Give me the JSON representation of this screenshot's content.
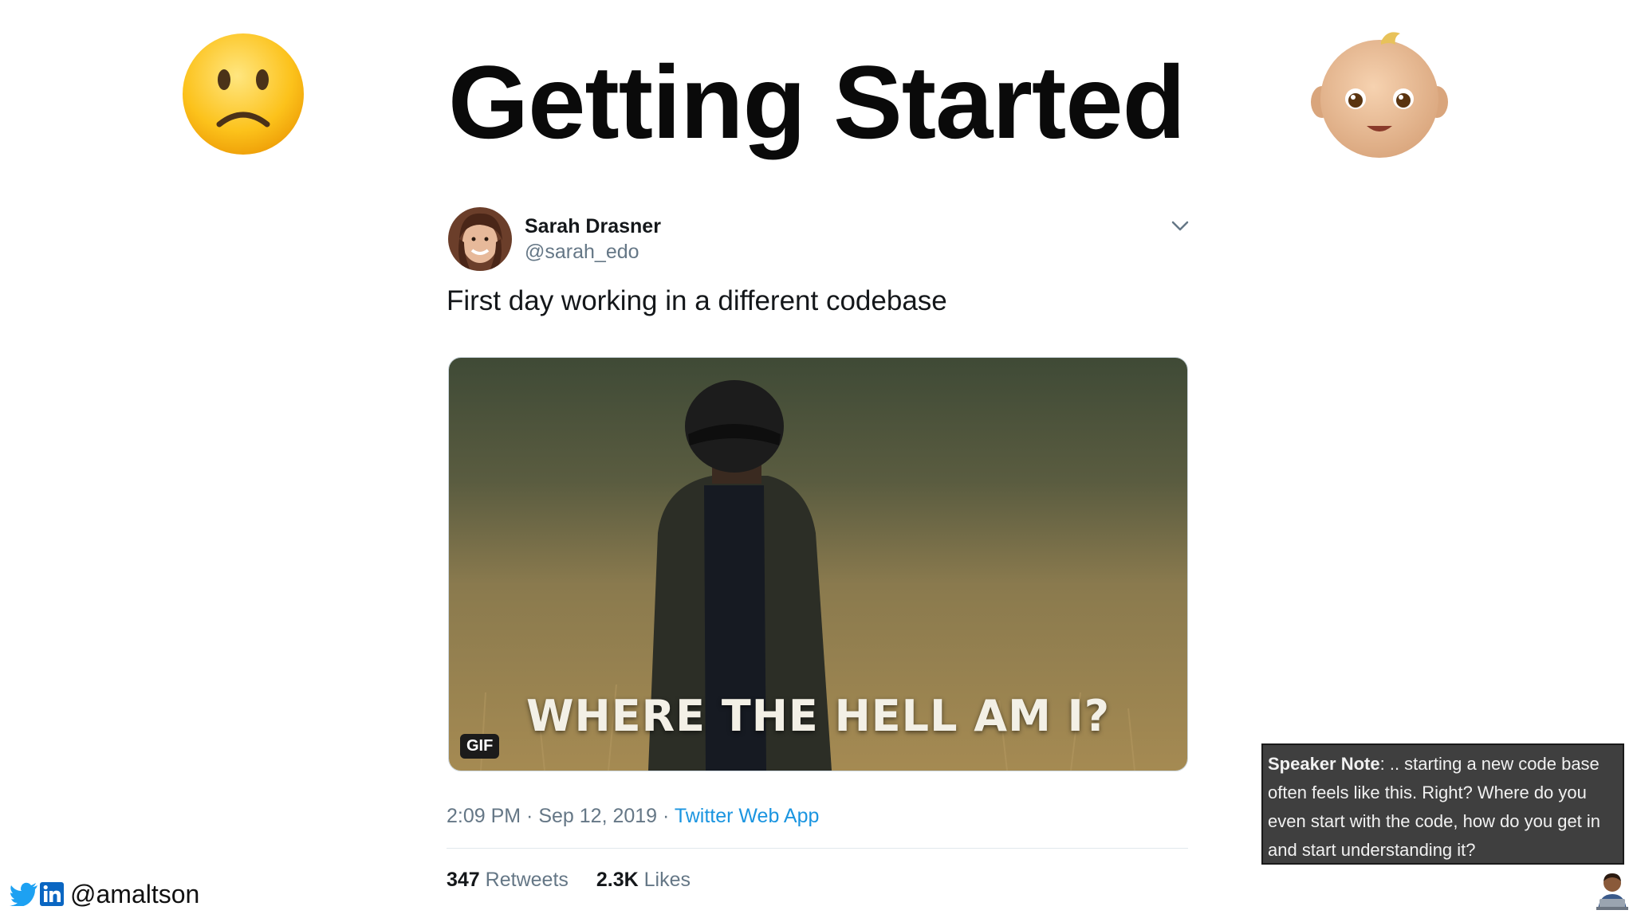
{
  "slide": {
    "title": "Getting Started",
    "left_emoji": "slightly-frowning-face-icon",
    "right_emoji": "baby-face-icon"
  },
  "tweet": {
    "author_name": "Sarah Drasner",
    "author_handle": "@sarah_edo",
    "text": "First day working in a different codebase",
    "media": {
      "caption": "WHERE THE HELL AM I?",
      "badge": "GIF"
    },
    "time": "2:09 PM",
    "separator": " · ",
    "date": "Sep 12, 2019",
    "app": "Twitter Web App",
    "retweets_count": "347",
    "retweets_label": "Retweets",
    "likes_count": "2.3K",
    "likes_label": "Likes"
  },
  "footer": {
    "handle": "@amaltson",
    "icons": [
      "twitter-icon",
      "linkedin-icon"
    ]
  },
  "speaker_note": {
    "label": "Speaker Note",
    "text": ": .. starting a new code base often feels like this. Right? Where do you even start with the code, how do you get in and start understanding it?"
  },
  "colors": {
    "twitter_blue": "#1da1f2",
    "linkedin_blue": "#0a66c2",
    "note_bg": "#3f3f3f"
  }
}
